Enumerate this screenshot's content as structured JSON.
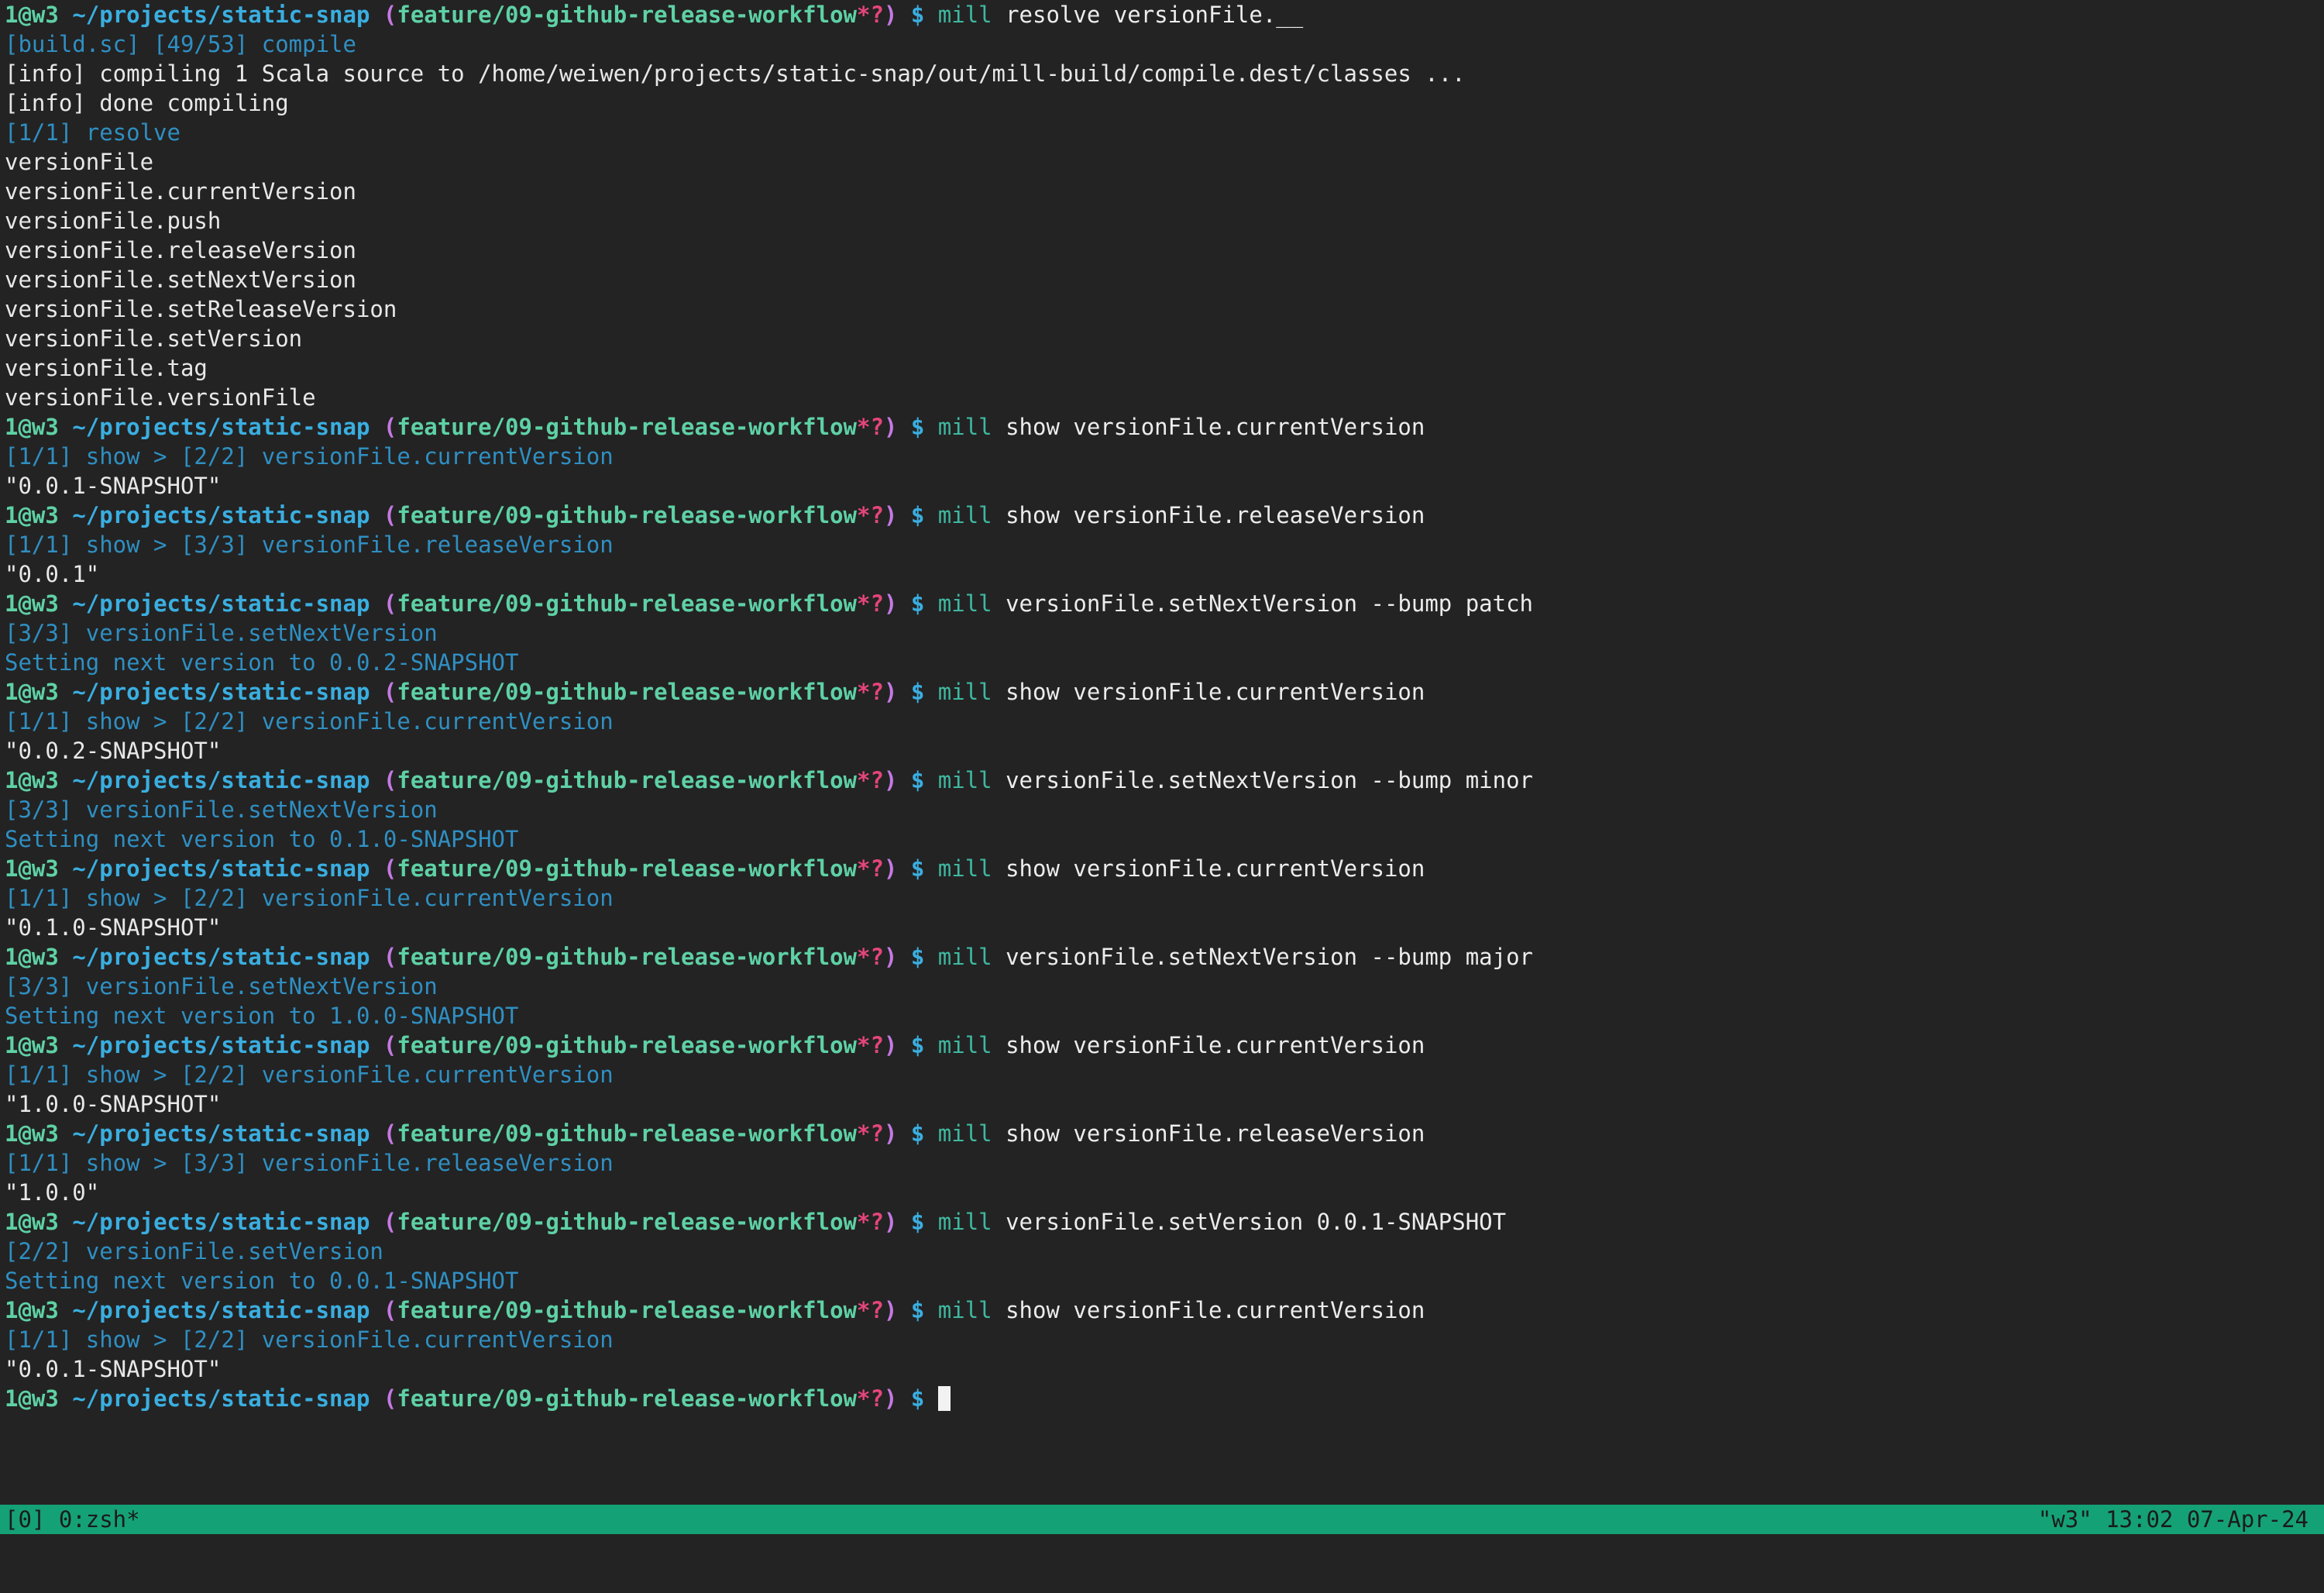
{
  "prompt": {
    "user": "1@w3",
    "path": "~/projects/static-snap",
    "branch_open": "(",
    "branch": "feature/09-github-release-workflow",
    "dirty": "*?",
    "branch_close": ")",
    "dollar": "$"
  },
  "lines": [
    {
      "kind": "prompt",
      "tool": "mill",
      "args": "resolve versionFile.__"
    },
    {
      "kind": "blue",
      "text": "[build.sc] [49/53] compile"
    },
    {
      "kind": "plain",
      "text": "[info] compiling 1 Scala source to /home/weiwen/projects/static-snap/out/mill-build/compile.dest/classes ..."
    },
    {
      "kind": "plain",
      "text": "[info] done compiling"
    },
    {
      "kind": "blue",
      "text": "[1/1] resolve"
    },
    {
      "kind": "plain",
      "text": "versionFile"
    },
    {
      "kind": "plain",
      "text": "versionFile.currentVersion"
    },
    {
      "kind": "plain",
      "text": "versionFile.push"
    },
    {
      "kind": "plain",
      "text": "versionFile.releaseVersion"
    },
    {
      "kind": "plain",
      "text": "versionFile.setNextVersion"
    },
    {
      "kind": "plain",
      "text": "versionFile.setReleaseVersion"
    },
    {
      "kind": "plain",
      "text": "versionFile.setVersion"
    },
    {
      "kind": "plain",
      "text": "versionFile.tag"
    },
    {
      "kind": "plain",
      "text": "versionFile.versionFile"
    },
    {
      "kind": "prompt",
      "tool": "mill",
      "args": "show versionFile.currentVersion"
    },
    {
      "kind": "blue",
      "text": "[1/1] show > [2/2] versionFile.currentVersion"
    },
    {
      "kind": "plain",
      "text": "\"0.0.1-SNAPSHOT\""
    },
    {
      "kind": "prompt",
      "tool": "mill",
      "args": "show versionFile.releaseVersion"
    },
    {
      "kind": "blue",
      "text": "[1/1] show > [3/3] versionFile.releaseVersion"
    },
    {
      "kind": "plain",
      "text": "\"0.0.1\""
    },
    {
      "kind": "prompt",
      "tool": "mill",
      "args": "versionFile.setNextVersion --bump patch"
    },
    {
      "kind": "blue",
      "text": "[3/3] versionFile.setNextVersion"
    },
    {
      "kind": "blue",
      "text": "Setting next version to 0.0.2-SNAPSHOT"
    },
    {
      "kind": "prompt",
      "tool": "mill",
      "args": "show versionFile.currentVersion"
    },
    {
      "kind": "blue",
      "text": "[1/1] show > [2/2] versionFile.currentVersion"
    },
    {
      "kind": "plain",
      "text": "\"0.0.2-SNAPSHOT\""
    },
    {
      "kind": "prompt",
      "tool": "mill",
      "args": "versionFile.setNextVersion --bump minor"
    },
    {
      "kind": "blue",
      "text": "[3/3] versionFile.setNextVersion"
    },
    {
      "kind": "blue",
      "text": "Setting next version to 0.1.0-SNAPSHOT"
    },
    {
      "kind": "prompt",
      "tool": "mill",
      "args": "show versionFile.currentVersion"
    },
    {
      "kind": "blue",
      "text": "[1/1] show > [2/2] versionFile.currentVersion"
    },
    {
      "kind": "plain",
      "text": "\"0.1.0-SNAPSHOT\""
    },
    {
      "kind": "prompt",
      "tool": "mill",
      "args": "versionFile.setNextVersion --bump major"
    },
    {
      "kind": "blue",
      "text": "[3/3] versionFile.setNextVersion"
    },
    {
      "kind": "blue",
      "text": "Setting next version to 1.0.0-SNAPSHOT"
    },
    {
      "kind": "prompt",
      "tool": "mill",
      "args": "show versionFile.currentVersion"
    },
    {
      "kind": "blue",
      "text": "[1/1] show > [2/2] versionFile.currentVersion"
    },
    {
      "kind": "plain",
      "text": "\"1.0.0-SNAPSHOT\""
    },
    {
      "kind": "prompt",
      "tool": "mill",
      "args": "show versionFile.releaseVersion"
    },
    {
      "kind": "blue",
      "text": "[1/1] show > [3/3] versionFile.releaseVersion"
    },
    {
      "kind": "plain",
      "text": "\"1.0.0\""
    },
    {
      "kind": "prompt",
      "tool": "mill",
      "args": "versionFile.setVersion 0.0.1-SNAPSHOT"
    },
    {
      "kind": "blue",
      "text": "[2/2] versionFile.setVersion"
    },
    {
      "kind": "blue",
      "text": "Setting next version to 0.0.1-SNAPSHOT"
    },
    {
      "kind": "prompt",
      "tool": "mill",
      "args": "show versionFile.currentVersion"
    },
    {
      "kind": "blue",
      "text": "[1/1] show > [2/2] versionFile.currentVersion"
    },
    {
      "kind": "plain",
      "text": "\"0.0.1-SNAPSHOT\""
    },
    {
      "kind": "prompt",
      "tool": "",
      "args": "",
      "cursor": true
    }
  ],
  "statusbar": {
    "left": "[0] 0:zsh*",
    "right": "\"w3\" 13:02 07-Apr-24"
  },
  "colors": {
    "background": "#232323",
    "statusbar": "#15a176",
    "user": "#5ed1a5",
    "path": "#3aaee0",
    "branch_paren": "#c479e2",
    "dirty_marker": "#e5457c",
    "info_blue": "#2f8fc2",
    "text": "#e8e8e8"
  }
}
